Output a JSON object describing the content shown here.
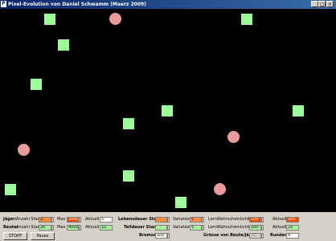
{
  "window": {
    "title": "Pixel-Evolution von Daniel Schwamm (Maerz 2009)",
    "icon": "app-icon"
  },
  "controls": {
    "jaeger_label": "Jäger:",
    "beute_label": "Beute:",
    "anzahl_start_label": "Anzahl Start",
    "max_label": "Max",
    "aktuell_label": "Aktuell",
    "jaeger_anzahl_start": "2",
    "jaeger_max": "2000",
    "jaeger_aktuell": "5",
    "beute_anzahl_start": "20",
    "beute_max": "4000",
    "beute_aktuell": "10",
    "lebensdauer_label": "Lebensdauer Start:",
    "teildauer_label": "Teildauer Start:",
    "variation_label": "Variation:",
    "lebensdauer_start": "",
    "lebensdauer_variation": "5",
    "teildauer_start": "",
    "teildauer_variation": "5",
    "lernw_label": "LernWahrscheinlichkeit",
    "lernw_1": "100",
    "lernw_2": "100",
    "aktuell_1": "100",
    "aktuell_2": "25",
    "bremse_label": "Bremse:",
    "bremse_value": "100",
    "groesse_label": "Grösse von Beute/Jäger:",
    "groesse_value": "10",
    "runden_label": "Runden:",
    "runden_value": "4",
    "stopp_label": "STOPP",
    "pause_label": "Pause"
  },
  "colors": {
    "prey": "#9cff9c",
    "hunter": "#ea9b9b",
    "background": "#000000"
  }
}
